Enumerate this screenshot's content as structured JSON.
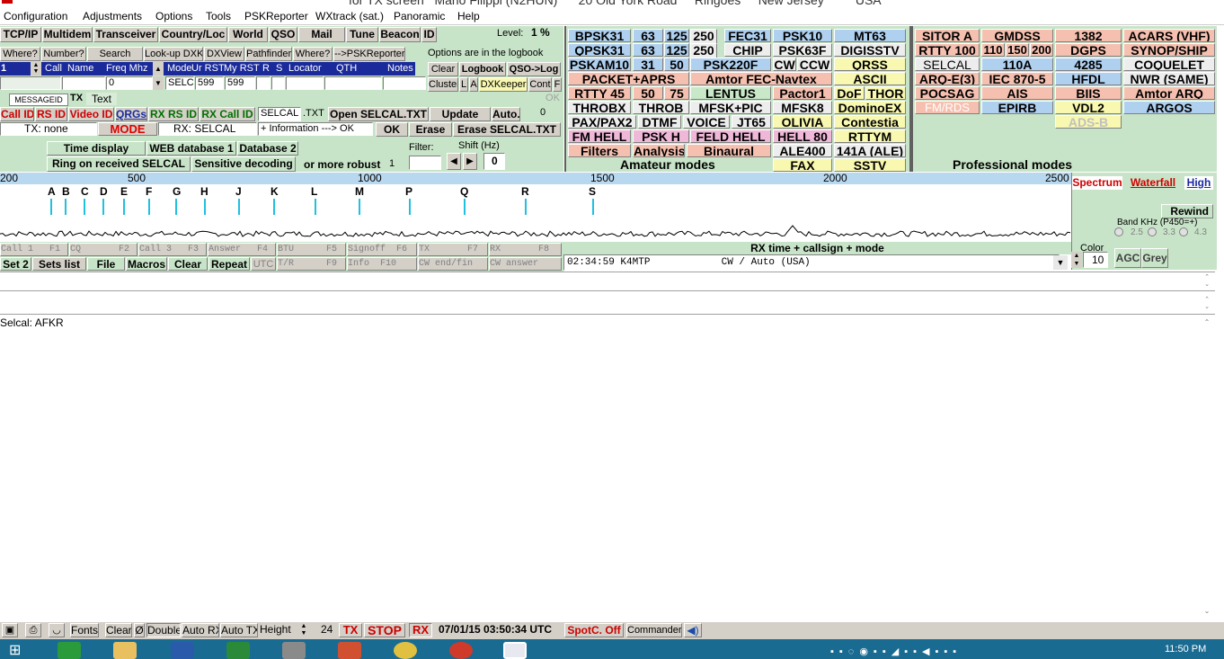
{
  "title_bar": {
    "text": "for TX screen   Mario Filippi (N2HUN)      20 Old York Road     Ringoes     New Jersey         USA"
  },
  "menu": [
    "Configuration",
    "Adjustments",
    "Options",
    "Tools",
    "PSKReporter",
    "WXtrack (sat.)",
    "Panoramic",
    "Help"
  ],
  "toolbar": {
    "buttons": [
      "TCP/IP",
      "Multidem",
      "Transceiver",
      "Country/Loc",
      "World",
      "QSO",
      "Mail",
      "Tune",
      "Beacon",
      "ID"
    ],
    "level_label": "Level:",
    "level_value": "1 %"
  },
  "qso_row": {
    "where": "Where?",
    "number": "Number?",
    "search": "Search",
    "lookup": "Look-up DXK",
    "dxview": "DXView",
    "pathfinder": "Pathfinder",
    "where2": "Where?",
    "pskreporter": "-->PSKReporter",
    "options_note": "Options are in the logbook",
    "col_call": "Call",
    "col_name": "Name",
    "col_freq": "Freq Mhz",
    "col_mode": "Mode",
    "col_ur": "Ur RST",
    "col_my": "My RST",
    "col_r": "R",
    "col_s": "S",
    "col_locator": "Locator",
    "col_qth": "QTH",
    "col_notes": "Notes",
    "row_num": "1",
    "freq_value": "0",
    "mode_value": "SELC",
    "ur_rst": "599",
    "my_rst": "599",
    "clear": "Clear",
    "logbook": "Logbook",
    "qso_log": "QSO->Log",
    "cluster": "Cluster",
    "l": "L",
    "a": "A",
    "dxkeeper": "DXKeeper",
    "cont": "Cont",
    "f": "F"
  },
  "tabs": {
    "messageid": "MESSAGEID",
    "tx": "TX",
    "text": "Text"
  },
  "controls": {
    "call_id": "Call ID",
    "rs_id": "RS ID",
    "video_id": "Video ID",
    "qrgs": "QRGs",
    "rx_rs_id": "RX RS ID",
    "rx_call_id": "RX Call ID",
    "selcal_file": "SELCAL",
    "ext": ".TXT",
    "open_selcal": "Open SELCAL.TXT",
    "update": "Update",
    "auto": "Auto.",
    "auto_value": "0",
    "tx_none": "TX: none",
    "mode": "MODE",
    "rx_selcal": "RX: SELCAL",
    "info": "+ Information ---> OK",
    "ok": "OK",
    "erase": "Erase",
    "erase_selcal": "Erase SELCAL.TXT",
    "time_display": "Time display",
    "web_db": "WEB database 1",
    "db2": "Database 2",
    "filter_label": "Filter:",
    "shift_label": "Shift (Hz)",
    "ring": "Ring on received SELCAL",
    "sensitive": "Sensitive decoding",
    "robust": "or more robust",
    "robust_value": "1",
    "shift_value": "0",
    "ok_gray": "OK"
  },
  "amateur_modes": {
    "rows": [
      [
        "BPSK31",
        "63",
        "125",
        "250",
        "FEC31",
        "PSK10",
        "MT63"
      ],
      [
        "QPSK31",
        "63",
        "125",
        "250",
        "CHIP",
        "PSK63F",
        "DIGISSTV"
      ],
      [
        "PSKAM10",
        "31",
        "50",
        "PSK220F",
        "CW",
        "CCW",
        "QRSS"
      ],
      [
        "PACKET+APRS",
        "Amtor FEC-Navtex",
        "ASCII"
      ],
      [
        "RTTY 45",
        "50",
        "75",
        "LENTUS",
        "Pactor1",
        "DoF",
        "THOR"
      ],
      [
        "THROBX",
        "THROB",
        "MFSK+PIC",
        "MFSK8",
        "DominoEX"
      ],
      [
        "PAX/PAX2",
        "DTMF",
        "VOICE",
        "JT65",
        "OLIVIA",
        "Contestia"
      ],
      [
        "FM HELL",
        "PSK H",
        "FELD HELL",
        "HELL 80",
        "RTTYM"
      ],
      [
        "Filters",
        "Analysis",
        "Binaural",
        "ALE400",
        "141A (ALE)"
      ],
      [
        "FAX",
        "SSTV"
      ]
    ],
    "footer": "Amateur modes"
  },
  "professional_modes": {
    "rows": [
      [
        "SITOR A",
        "GMDSS",
        "1382",
        "ACARS (VHF)"
      ],
      [
        "RTTY 100",
        "110",
        "150",
        "200",
        "DGPS",
        "SYNOP/SHIP"
      ],
      [
        "SELCAL",
        "110A",
        "4285",
        "COQUELET"
      ],
      [
        "ARQ-E(3)",
        "IEC 870-5",
        "HFDL",
        "NWR (SAME)"
      ],
      [
        "POCSAG",
        "AIS",
        "BIIS",
        "Amtor ARQ"
      ],
      [
        "FM/RDS",
        "EPIRB",
        "VDL2",
        "ARGOS"
      ],
      [
        "ADS-B"
      ]
    ],
    "footer": "Professional modes"
  },
  "spectrum": {
    "scale": [
      "200",
      "500",
      "1000",
      "1500",
      "2000",
      "2500"
    ],
    "tones": [
      "A",
      "B",
      "C",
      "D",
      "E",
      "F",
      "G",
      "H",
      "J",
      "K",
      "L",
      "M",
      "P",
      "Q",
      "R",
      "S"
    ]
  },
  "side_panel": {
    "spectrum": "Spectrum",
    "waterfall": "Waterfall",
    "high": "High",
    "rewind": "Rewind",
    "band_label": "Band KHz (P450=+)",
    "band_opts": [
      "2.5",
      "3.3",
      "4.3"
    ],
    "color_label": "Color",
    "color_value": "10",
    "agc": "AGC",
    "grey": "Grey"
  },
  "macros": {
    "fkeys": [
      "Call 1   F1",
      "CQ       F2",
      "Call 3   F3",
      "Answer   F4",
      "BTU      F5",
      "Signoff  F6",
      "TX       F7",
      "RX       F8"
    ],
    "bottom": [
      "Set 2",
      "Sets list",
      "File",
      "Macros",
      "Clear",
      "Repeat",
      "UTC",
      "T/R      F9",
      "Info  F10",
      "CW end/fin",
      "CW answer"
    ]
  },
  "rx_log": {
    "header": "RX time + callsign + mode",
    "entry": "02:34:59 K4MTP            CW / Auto (USA)"
  },
  "rx_text": "Selcal: AFKR",
  "status_bar": {
    "fonts": "Fonts",
    "clear": "Clear",
    "zero": "Ø",
    "double": "Double",
    "auto_rx": "Auto RX",
    "auto_tx": "Auto TX",
    "height": "Height",
    "height_value": "24",
    "tx": "TX",
    "stop": "STOP",
    "rx": "RX",
    "datetime": "07/01/15 03:50:34 UTC",
    "spotc": "SpotC. Off",
    "commander": "Commander"
  },
  "taskbar": {
    "time": "11:50 PM"
  }
}
